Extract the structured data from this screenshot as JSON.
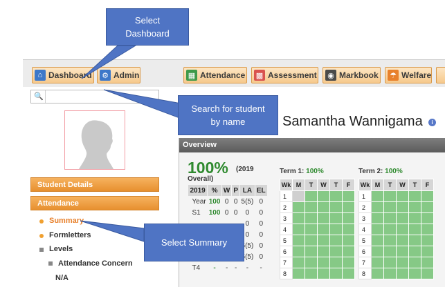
{
  "nav": {
    "dashboard": "Dashboard",
    "admin": "Admin",
    "attendance": "Attendance",
    "assessment": "Assessment",
    "markbook": "Markbook",
    "welfare": "Welfare"
  },
  "search": {
    "placeholder": "",
    "value": ""
  },
  "sidebar": {
    "student_details": "Student Details",
    "attendance": "Attendance",
    "summary": "Summary",
    "formletters": "Formletters",
    "levels": "Levels",
    "attendance_concern": "Attendance Concern",
    "na": "N/A"
  },
  "student": {
    "name": "Samantha Wannigama"
  },
  "overview": {
    "title": "Overview",
    "overall_pct": "100%",
    "overall_year": "(2019",
    "overall_word": "Overall)",
    "table": {
      "headers": [
        "2019",
        "%",
        "W",
        "P",
        "LA",
        "EL"
      ],
      "rows": [
        [
          "Year",
          "100",
          "0",
          "0",
          "5(5)",
          "0"
        ],
        [
          "S1",
          "100",
          "0",
          "0",
          "0",
          "0"
        ],
        [
          "",
          "",
          "",
          "",
          "0",
          "0"
        ],
        [
          "",
          "",
          "",
          "",
          "0",
          "0"
        ],
        [
          "",
          "",
          "",
          "",
          "5(5)",
          "0"
        ],
        [
          "",
          "",
          "",
          "",
          "5(5)",
          "0"
        ],
        [
          "T4",
          "-",
          "-",
          "-",
          "-",
          "-"
        ]
      ]
    },
    "term1": {
      "label": "Term 1:",
      "pct": "100%"
    },
    "term2": {
      "label": "Term 2:",
      "pct": "100%"
    },
    "grid_headers": [
      "Wk",
      "M",
      "T",
      "W",
      "T",
      "F"
    ],
    "weeks": [
      "1",
      "2",
      "3",
      "4",
      "5",
      "6",
      "7",
      "8"
    ]
  },
  "callouts": {
    "dashboard": "Select\nDashboard",
    "search": "Search for student\nby name",
    "summary": "Select Summary"
  },
  "colors": {
    "nav_button": "#f6c98c",
    "sidebar_header": "#e7902f",
    "present_green": "#86c986",
    "callout_blue": "#4f74c4",
    "overview_header": "#666666"
  }
}
